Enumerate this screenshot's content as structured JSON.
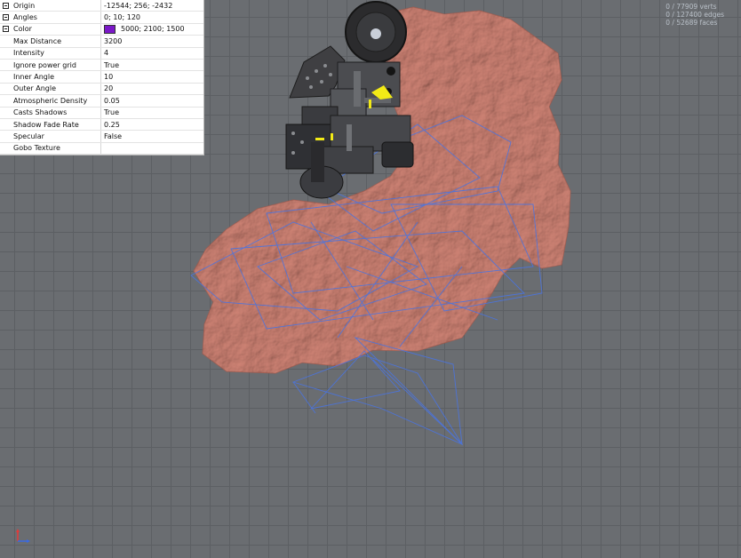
{
  "properties": [
    {
      "expander": true,
      "name": "Origin",
      "value": "-12544; 256; -2432"
    },
    {
      "expander": true,
      "name": "Angles",
      "value": "0; 10; 120"
    },
    {
      "expander": true,
      "name": "Color",
      "value": "5000; 2100; 1500",
      "swatch": "#7b18c8"
    },
    {
      "expander": false,
      "name": "Max Distance",
      "value": "3200"
    },
    {
      "expander": false,
      "name": "Intensity",
      "value": "4"
    },
    {
      "expander": false,
      "name": "Ignore power grid",
      "value": "True"
    },
    {
      "expander": false,
      "name": "Inner Angle",
      "value": "10"
    },
    {
      "expander": false,
      "name": "Outer Angle",
      "value": "20"
    },
    {
      "expander": false,
      "name": "Atmospheric Density",
      "value": "0.05"
    },
    {
      "expander": false,
      "name": "Casts Shadows",
      "value": "True"
    },
    {
      "expander": false,
      "name": "Shadow Fade Rate",
      "value": "0.25"
    },
    {
      "expander": false,
      "name": "Specular",
      "value": "False"
    },
    {
      "expander": false,
      "name": "Gobo Texture",
      "value": ""
    }
  ],
  "stats": {
    "verts": "0 / 77909 verts",
    "edges": "0 / 127400 edges",
    "faces": "0 / 52689 faces"
  },
  "colors": {
    "terrain": "#c2776a",
    "wireframe": "#4a74e0",
    "highlight": "#f2ea16",
    "grid": "#5c5f63",
    "background": "#6a6d71"
  },
  "icons": {
    "expander": "collapse-box-icon",
    "axis": "axis-gizmo-icon"
  }
}
